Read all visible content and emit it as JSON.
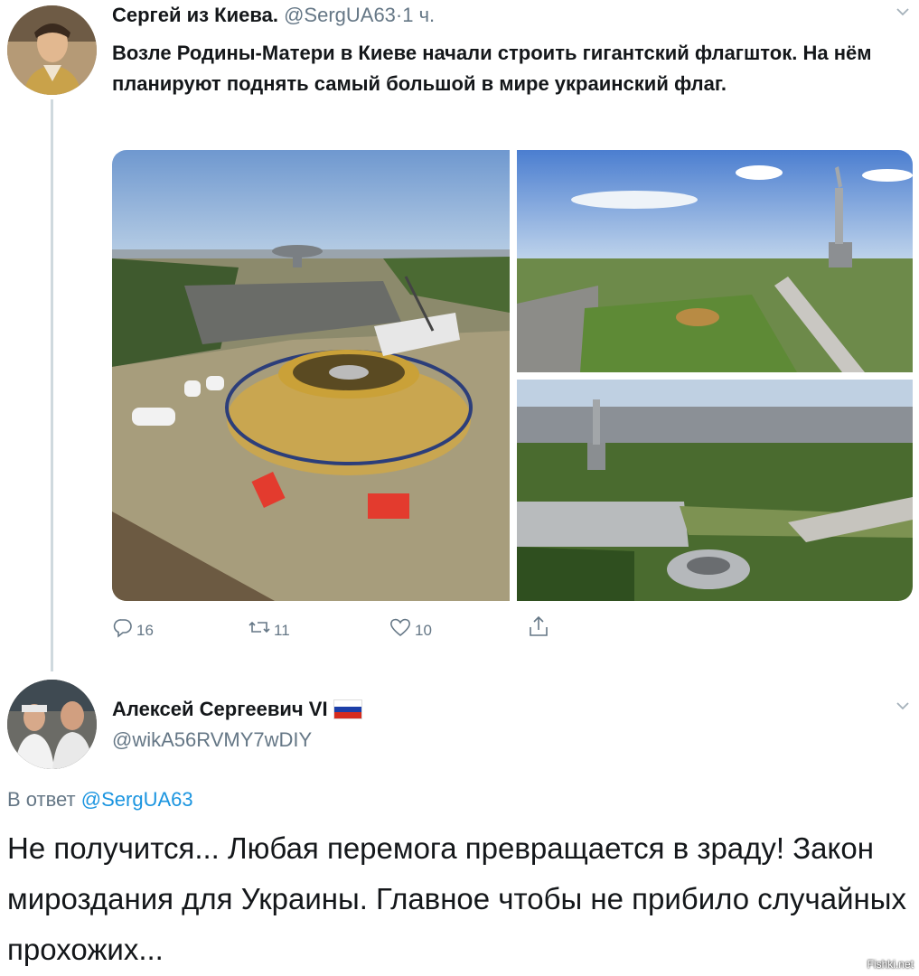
{
  "tweet1": {
    "author_name": "Сергей из Киева.",
    "handle": "@SergUA63",
    "separator": "·",
    "time": "1 ч.",
    "text": "Возле Родины-Матери в Киеве начали строить гигантский флагшток. На нём планируют поднять самый большой  в мире украинский флаг.",
    "actions": {
      "replies": "16",
      "retweets": "11",
      "likes": "10"
    },
    "icons": [
      "reply-icon",
      "retweet-icon",
      "like-icon",
      "share-icon",
      "chevron-down-icon"
    ]
  },
  "tweet2": {
    "author_name": "Алексей Сергеевич VI",
    "flag_colors": [
      "#ffffff",
      "#1c3fa8",
      "#d52b1e"
    ],
    "handle": "@wikA56RVMY7wDIY",
    "reply_prefix": "В ответ",
    "reply_to": "@SergUA63",
    "text": "Не получится... Любая перемога превращается в зраду! Закон мироздания для Украины. Главное чтобы не прибило случайных прохожих..."
  },
  "watermark": "Fishki.net",
  "colors": {
    "link": "#1b95e0",
    "secondary": "#657786",
    "line": "#cfd9de"
  }
}
